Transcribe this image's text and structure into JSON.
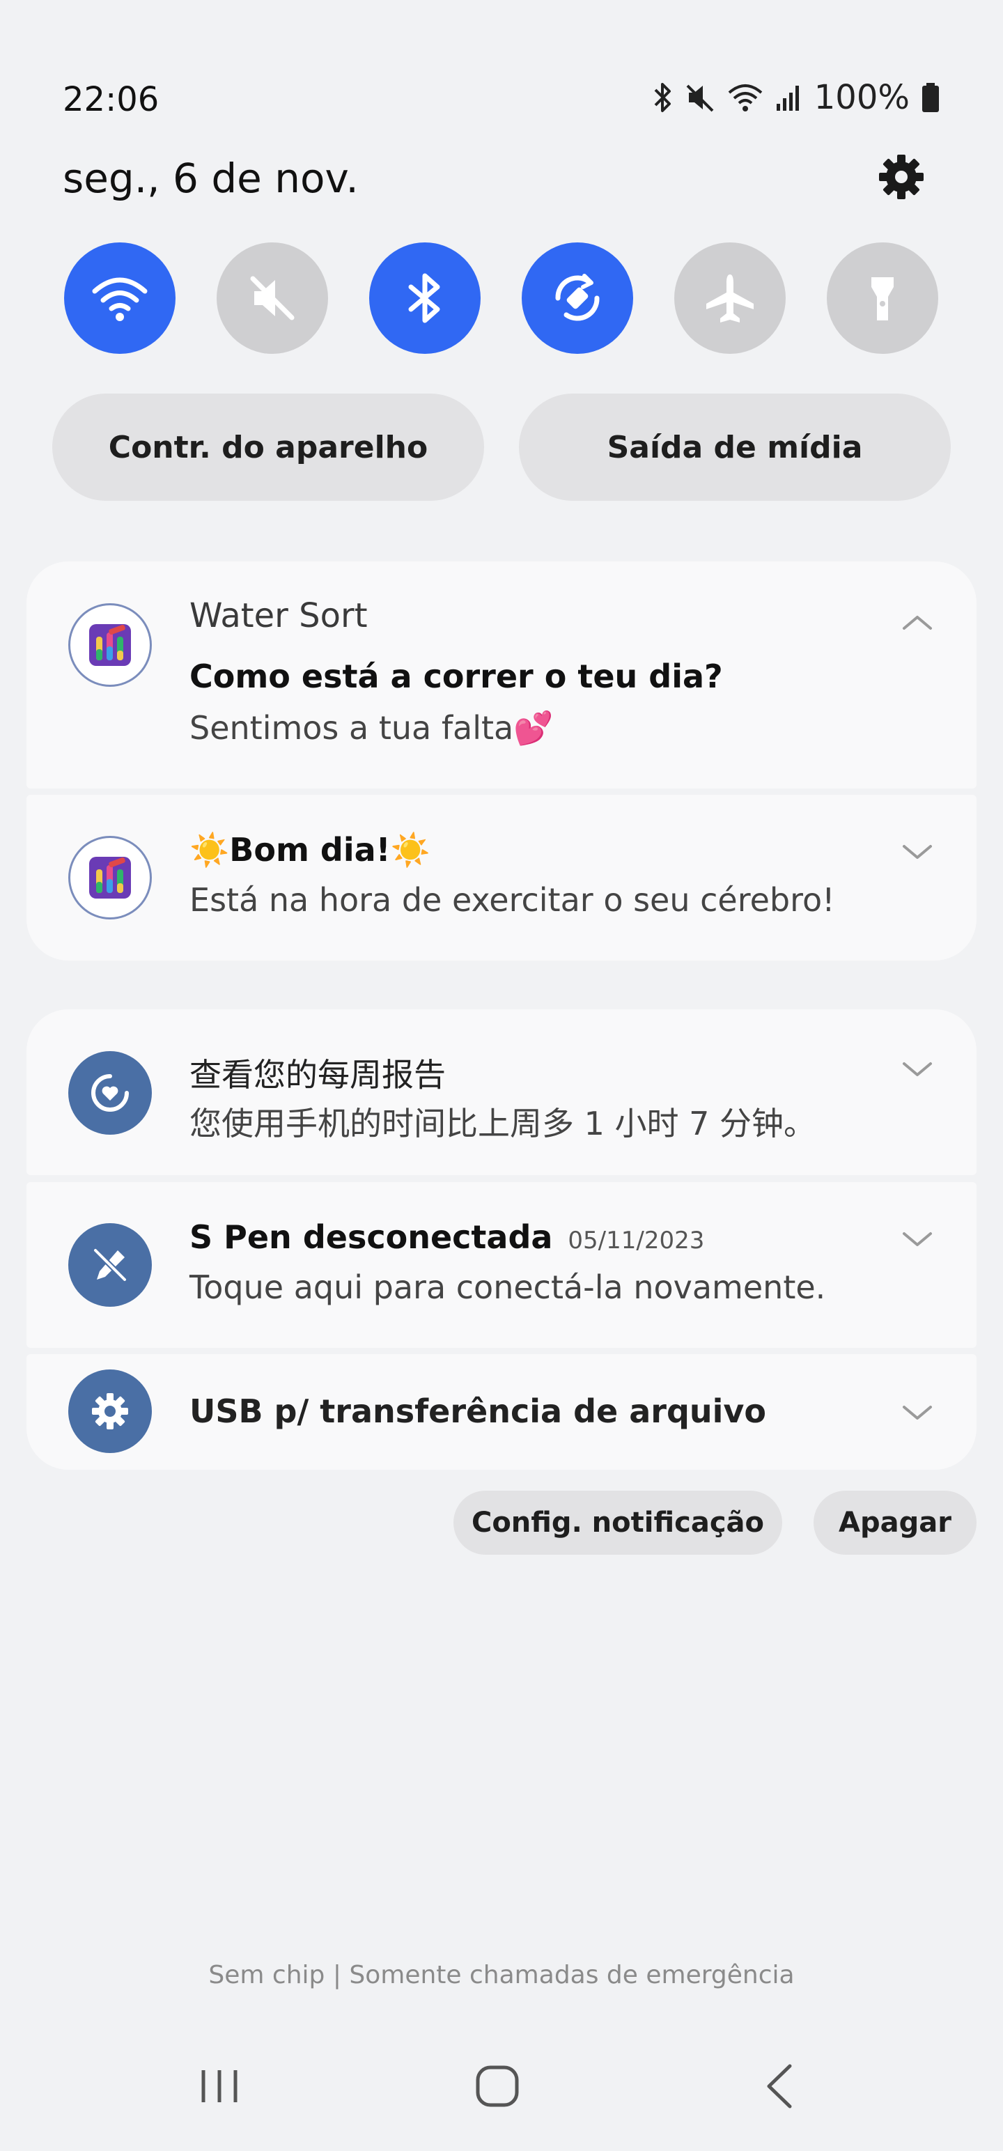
{
  "status_bar": {
    "time": "22:06",
    "battery": "100%",
    "icons": [
      "bluetooth-icon",
      "mute-icon",
      "wifi-icon",
      "signal-icon",
      "battery-icon"
    ]
  },
  "header": {
    "date": "seg., 6 de nov.",
    "settings_icon": "gear-icon"
  },
  "quick_tiles": [
    {
      "name": "wifi",
      "icon": "wifi-icon",
      "state": "on"
    },
    {
      "name": "sound",
      "icon": "mute-icon",
      "state": "off"
    },
    {
      "name": "bluetooth",
      "icon": "bluetooth-icon",
      "state": "on"
    },
    {
      "name": "auto-rotate",
      "icon": "rotate-icon",
      "state": "on"
    },
    {
      "name": "airplane",
      "icon": "airplane-icon",
      "state": "off"
    },
    {
      "name": "flashlight",
      "icon": "flashlight-icon",
      "state": "off"
    }
  ],
  "pills": {
    "device_control": "Contr. do aparelho",
    "media_output": "Saída de mídia"
  },
  "notifications": {
    "water_sort": {
      "app": "Water Sort",
      "title": "Como está a correr o teu dia?",
      "body": "Sentimos a tua falta💕"
    },
    "water_sort_2": {
      "title": "☀️Bom dia!☀️",
      "body": "Está na hora de exercitar o seu cérebro!"
    },
    "weekly_report": {
      "title": "查看您的每周报告",
      "body": "您使用手机的时间比上周多 1 小时 7 分钟。"
    },
    "s_pen": {
      "title": "S Pen desconectada",
      "date": "05/11/2023",
      "body": "Toque aqui para conectá-la novamente."
    },
    "usb": {
      "title": "USB p/ transferência de arquivo"
    }
  },
  "actions": {
    "notification_settings": "Config. notificação",
    "clear": "Apagar"
  },
  "footer": {
    "carrier": "Sem chip | Somente chamadas de emergência"
  },
  "colors": {
    "accent": "#3068f3",
    "tile_off": "#cfcfd1",
    "system_icon": "#4a6fa5",
    "background": "#f1f2f4"
  }
}
